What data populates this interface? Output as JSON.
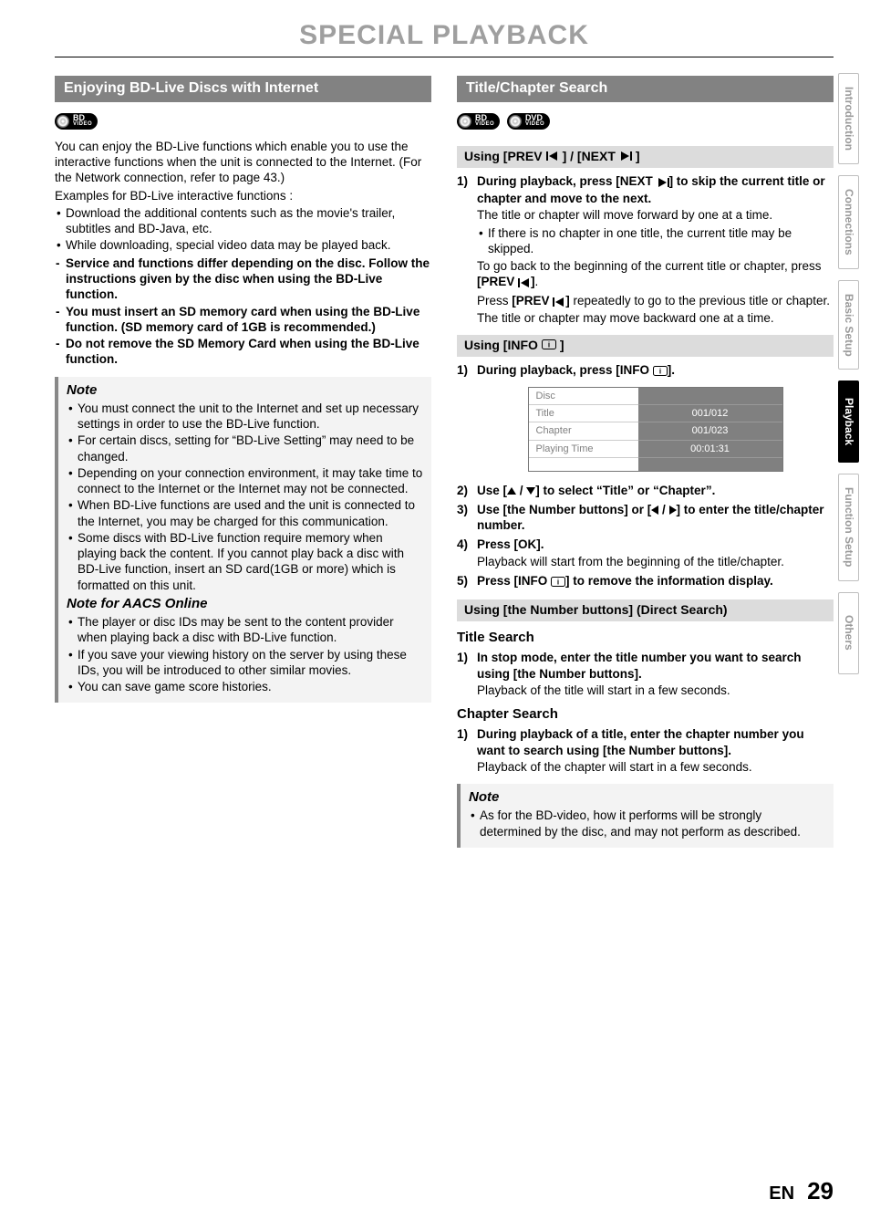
{
  "page_title": "SPECIAL PLAYBACK",
  "left": {
    "header": "Enjoying BD-Live Discs with Internet",
    "disc_badges": [
      {
        "top": "BD",
        "sub": "VIDEO"
      }
    ],
    "intro": "You can enjoy the BD-Live functions which enable you to use the interactive functions when the unit is connected to the Internet. (For the Network connection, refer to page 43.)",
    "examples_label": "Examples for BD-Live interactive functions :",
    "bullets": [
      "Download the additional contents such as the movie's trailer, subtitles and BD-Java, etc.",
      "While downloading, special video data may be played back."
    ],
    "dashes": [
      "Service and functions differ depending on the disc. Follow the instructions given by the disc when using the BD-Live function.",
      "You must insert an SD memory card when using the BD-Live function. (SD memory card of 1GB is recommended.)",
      "Do not remove the SD Memory Card when using the BD-Live function."
    ],
    "note_title": "Note",
    "note_items": [
      "You must connect the unit to the Internet and set up necessary settings in order to use the BD-Live function.",
      " For certain discs, setting for “BD-Live Setting” may need to be changed.",
      "Depending on your connection environment, it may take time to connect to the Internet or the Internet may not be connected.",
      "When BD-Live functions are used and the unit is connected to the Internet, you may be charged for this communication.",
      "Some discs with BD-Live function require memory when playing back the content. If you cannot play back a disc with BD-Live function, insert an SD card(1GB or more) which is formatted on this unit."
    ],
    "aacs_title": "Note for AACS Online",
    "aacs_items": [
      "The player or disc IDs may be sent to the content provider when playing back a disc with BD-Live function.",
      "If you save your viewing history on the server by using these IDs, you will be introduced to other similar movies.",
      "You can save game score histories."
    ]
  },
  "right": {
    "header": "Title/Chapter Search",
    "disc_badges": [
      {
        "top": "BD",
        "sub": "VIDEO"
      },
      {
        "top": "DVD",
        "sub": "VIDEO"
      }
    ],
    "sub1_label_pre": "Using [PREV ",
    "sub1_label_mid": "] / [NEXT ",
    "sub1_label_post": "]",
    "step1_lead_pre": "During playback, press [NEXT ",
    "step1_lead_post": "] to skip the current title or chapter and move to the next.",
    "step1_line1": "The title or chapter will move forward by one at a time.",
    "step1_bullet": "If there is no chapter in one title, the current title may be skipped.",
    "step1_goback_pre": "To go back to the beginning of the current title or chapter, press ",
    "step1_goback_bold": "[PREV ",
    "step1_goback_bold_post": "]",
    "step1_goback_post": ".",
    "step1_press_pre": "Press ",
    "step1_press_bold": "[PREV ",
    "step1_press_bold_post": "]",
    "step1_press_post": " repeatedly to go to the previous title or chapter. The title or chapter may move backward one at a time.",
    "sub2_label_pre": "Using [INFO ",
    "sub2_label_post": "]",
    "info_step1_pre": "During playback, press [INFO ",
    "info_step1_post": "].",
    "osd_rows": [
      {
        "label": "Disc",
        "value": ""
      },
      {
        "label": "Title",
        "value": "001/012"
      },
      {
        "label": "Chapter",
        "value": "001/023"
      },
      {
        "label": "Playing Time",
        "value": "00:01:31"
      }
    ],
    "info_step2": "Use [ ▲ / ▼] to select “Title” or “Chapter”.",
    "info_step3": "Use [the Number buttons] or [ ◀ / ▶ ] to enter the title/chapter number.",
    "info_step4_lead": "Press [OK].",
    "info_step4_sub": "Playback will start from the beginning of the title/chapter.",
    "info_step5_pre": "Press [INFO ",
    "info_step5_post": "] to remove the information display.",
    "sub3_label": "Using [the Number buttons] (Direct Search)",
    "title_search_header": "Title Search",
    "title_search_lead": "In stop mode, enter the title number you want to search using [the Number buttons].",
    "title_search_sub": "Playback of the title will start in a few seconds.",
    "chapter_search_header": "Chapter Search",
    "chapter_search_lead": "During playback of a title, enter the chapter number you want to search using [the Number buttons].",
    "chapter_search_sub": "Playback of the chapter will start in a few seconds.",
    "note_title": "Note",
    "note_item": "As for the BD-video, how it performs will be strongly determined by the disc, and may not perform as described."
  },
  "tabs": [
    "Introduction",
    "Connections",
    "Basic Setup",
    "Playback",
    "Function Setup",
    "Others"
  ],
  "active_tab": "Playback",
  "footer": {
    "lang": "EN",
    "page": "29"
  }
}
